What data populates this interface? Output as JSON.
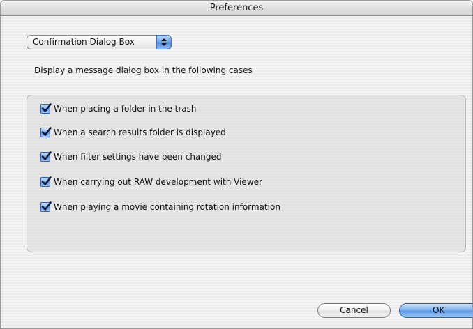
{
  "window": {
    "title": "Preferences"
  },
  "category_popup": {
    "selected": "Confirmation Dialog Box",
    "icon": "up-down-arrows-icon"
  },
  "description": "Display a message dialog box in the following cases",
  "options": [
    {
      "label": "When placing a folder in the trash",
      "checked": true
    },
    {
      "label": "When a search results folder is displayed",
      "checked": true
    },
    {
      "label": "When filter settings have been changed",
      "checked": true
    },
    {
      "label": "When carrying out RAW development with Viewer",
      "checked": true
    },
    {
      "label": "When playing a movie containing rotation information",
      "checked": true
    }
  ],
  "buttons": {
    "cancel": "Cancel",
    "ok": "OK"
  },
  "colors": {
    "accent": "#5b92e3",
    "checkmark": "#0d1a3a"
  }
}
